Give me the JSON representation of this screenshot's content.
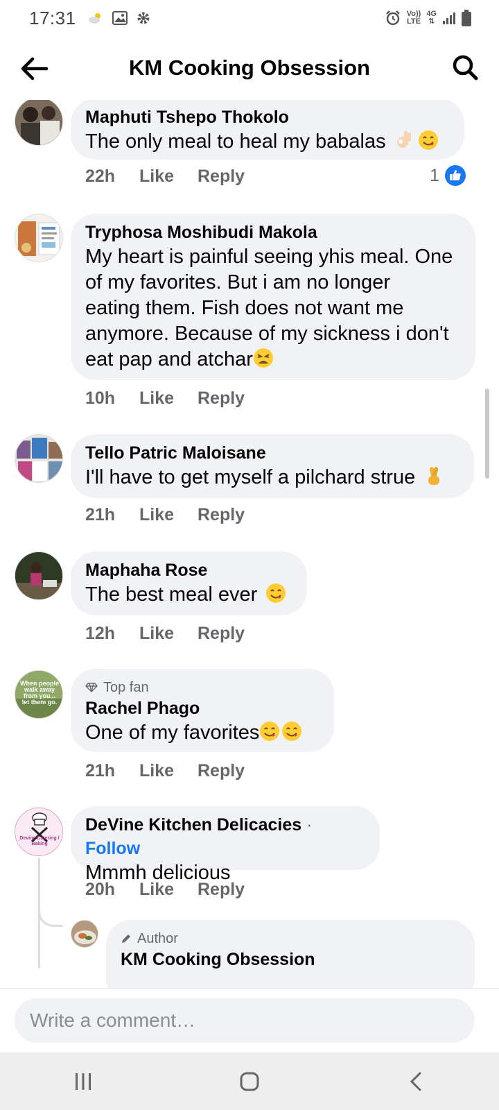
{
  "status_bar": {
    "time": "17:31",
    "network_vo": "Vo))",
    "network_lte": "LTE",
    "network_4g": "4G"
  },
  "header": {
    "title": "KM Cooking Obsession",
    "back_icon": "arrow-left-icon",
    "search_icon": "search-icon"
  },
  "comments": [
    {
      "name": "Maphuti Tshepo Thokolo",
      "text": "The only meal to heal my babalas",
      "emojis": [
        "ok-hand-emoji",
        "yum-face-emoji"
      ],
      "time": "22h",
      "like": "Like",
      "reply": "Reply",
      "reaction_count": "1"
    },
    {
      "name": "Tryphosa Moshibudi Makola",
      "text": "My heart is painful seeing yhis meal. One\nof my favorites.  But i am no longer\neating them.  Fish does not want me\nanymore. Because of my sickness i don't\neat pap and atchar",
      "emojis": [
        "weary-face-emoji"
      ],
      "time": "10h",
      "like": "Like",
      "reply": "Reply"
    },
    {
      "name": "Tello Patric Maloisane",
      "text": "I'll have to get myself a pilchard strue",
      "emojis": [
        "crossed-fingers-emoji"
      ],
      "time": "21h",
      "like": "Like",
      "reply": "Reply"
    },
    {
      "name": "Maphaha Rose",
      "text": "The best meal ever",
      "emojis": [
        "yum-face-emoji"
      ],
      "time": "12h",
      "like": "Like",
      "reply": "Reply"
    },
    {
      "badge": "Top fan",
      "name": "Rachel Phago",
      "text": "One of my favorites",
      "emojis": [
        "yum-face-emoji",
        "yum-face-emoji"
      ],
      "time": "21h",
      "like": "Like",
      "reply": "Reply",
      "avatar_text": "When people walk away from you... let them go."
    },
    {
      "name": "DeVine Kitchen Delicacies",
      "follow": "Follow",
      "text": "Mmmh delicious",
      "time": "20h",
      "like": "Like",
      "reply": "Reply",
      "avatar_text": "Devine Catering / Baking"
    }
  ],
  "reply": {
    "badge": "Author",
    "name": "KM Cooking Obsession"
  },
  "composer": {
    "placeholder": "Write a comment…"
  },
  "colors": {
    "accent": "#1877f2",
    "bubble": "#f0f2f5",
    "secondary_text": "#65676b"
  }
}
